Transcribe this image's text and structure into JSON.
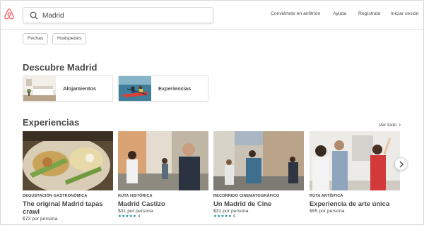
{
  "header": {
    "search_value": "Madrid",
    "nav": [
      "Conviértete en anfitrión",
      "Ayuda",
      "Regístrate",
      "Iniciar sesión"
    ]
  },
  "filters": [
    "Fechas",
    "Huéspedes"
  ],
  "discover": {
    "title": "Descubre Madrid",
    "cards": [
      {
        "label": "Alojamientos",
        "icon": "bedroom-photo"
      },
      {
        "label": "Experiencias",
        "icon": "kayak-photo"
      }
    ]
  },
  "experiences": {
    "title": "Experiencias",
    "see_all": "Ver todo",
    "items": [
      {
        "category": "DEGUSTACIÓN GASTRONÓMICA",
        "title": "The original Madrid tapas crawl",
        "price": "$73 por persona",
        "stars": "",
        "count": ""
      },
      {
        "category": "RUTA HISTÓRICA",
        "title": "Madrid Castizo",
        "price": "$31 por persona",
        "stars": "★★★★★",
        "count": "4"
      },
      {
        "category": "RECORRIDO CINEMATOGRÁFICO",
        "title": "Un Madrid de Cine",
        "price": "$31 por persona",
        "stars": "★★★★★",
        "count": "6"
      },
      {
        "category": "RUTA ARTÍSTICA",
        "title": "Experiencia de arte única",
        "price": "$55 por persona",
        "stars": "",
        "count": ""
      }
    ]
  },
  "colors": {
    "brand": "#FF5A5F",
    "rating": "#008489",
    "text": "#484848"
  }
}
